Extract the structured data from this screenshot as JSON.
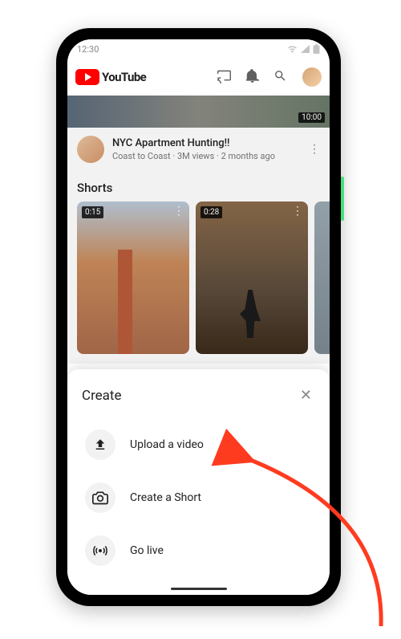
{
  "status": {
    "time": "12:30"
  },
  "brand": "YouTube",
  "hero": {
    "duration": "10:00"
  },
  "video": {
    "title": "NYC Apartment Hunting!!",
    "channel": "Coast to Coast",
    "views": "3M views",
    "age": "2 months ago"
  },
  "shorts": {
    "heading": "Shorts",
    "items": [
      {
        "duration": "0:15"
      },
      {
        "duration": "0:28"
      }
    ]
  },
  "sheet": {
    "title": "Create",
    "upload": "Upload a video",
    "short": "Create a Short",
    "live": "Go live"
  }
}
